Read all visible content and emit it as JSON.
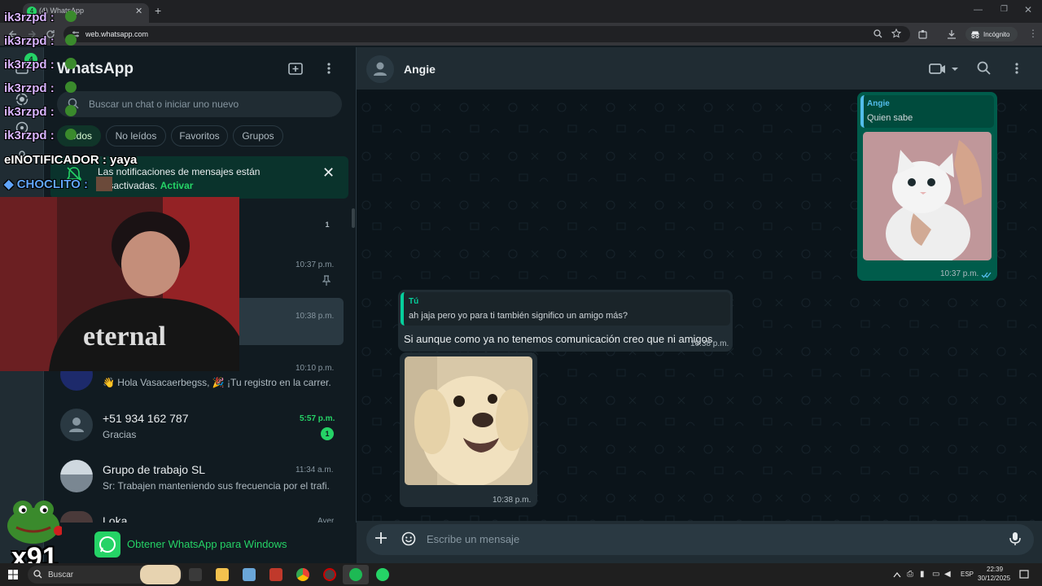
{
  "browser": {
    "tab_title": "(4) WhatsApp",
    "tab_badge": "4",
    "url": "web.whatsapp.com",
    "incognito_label": "Incógnito"
  },
  "sidebar": {
    "app_title": "WhatsApp",
    "search_placeholder": "Buscar un chat o iniciar uno nuevo",
    "filters": [
      "Todos",
      "No leídos",
      "Favoritos",
      "Grupos"
    ],
    "notification": {
      "text": "Las notificaciones de mensajes están desactivadas.",
      "action": "Activar"
    },
    "chats": [
      {
        "name": "",
        "preview": "",
        "time": "",
        "unread": "1"
      },
      {
        "name": "",
        "preview": "",
        "time": "10:37 p.m.",
        "pinned": true
      },
      {
        "name": "",
        "preview": "",
        "time": "10:38 p.m.",
        "selected": true
      },
      {
        "name": "",
        "preview": "👋 Hola Vasacaerbegss, 🎉 ¡Tu registro en la carrer...",
        "time": "10:10 p.m."
      },
      {
        "name": "+51 934 162 787",
        "preview": "Gracias",
        "time": "5:57 p.m.",
        "unread": "1"
      },
      {
        "name": "Grupo de trabajo SL",
        "preview": "Sr: Trabajen manteniendo sus frecuencia por el trafi...",
        "time": "11:34 a.m."
      },
      {
        "name": "Loka",
        "preview": "",
        "time": "Ayer"
      }
    ],
    "get_app": "Obtener WhatsApp para Windows"
  },
  "chat": {
    "contact_name": "Angie",
    "messages": [
      {
        "direction": "out",
        "quote_author": "Angie",
        "quote_text": "Quien sabe",
        "image": "white-cat-photo",
        "time": "10:37 p.m."
      },
      {
        "direction": "in",
        "quote_author": "Tú",
        "quote_text": "ah jaja pero yo para ti también significo un amigo más?",
        "text": "Si aunque como ya no tenemos comunicación creo que ni amigos",
        "time": "10:38 p.m."
      },
      {
        "direction": "in",
        "image": "puppy-photo",
        "time": "10:38 p.m."
      }
    ],
    "composer_placeholder": "Escribe un mensaje"
  },
  "overlay": {
    "chat_lines": [
      {
        "user": "ik3rzpd",
        "text": ":"
      },
      {
        "user": "ik3rzpd",
        "text": ":"
      },
      {
        "user": "ik3rzpd",
        "text": ":"
      },
      {
        "user": "ik3rzpd",
        "text": ":"
      },
      {
        "user": "ik3rzpd",
        "text": ":"
      },
      {
        "user": "ik3rzpd",
        "text": ":"
      },
      {
        "user": "eINOTIFICADOR",
        "text": ": yaya"
      },
      {
        "user": "CHOCLITO",
        "text": ":"
      }
    ],
    "score": "x91"
  },
  "taskbar": {
    "search_label": "Buscar",
    "language": "ESP",
    "time": "22:39",
    "date": "30/12/2025"
  },
  "colors": {
    "accent": "#25d366",
    "outgoing_bubble": "#005c4b",
    "incoming_bubble": "#202c33",
    "background": "#0b141a"
  }
}
